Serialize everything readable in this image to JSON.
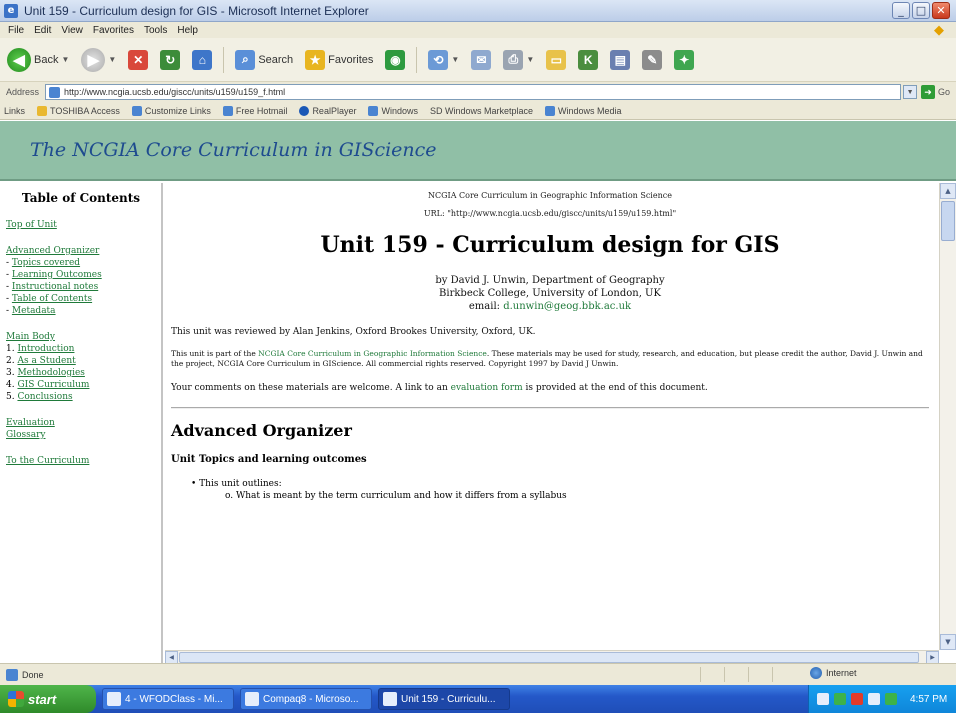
{
  "window": {
    "title": "Unit 159 - Curriculum design for GIS - Microsoft Internet Explorer",
    "controls": {
      "minimize": "_",
      "maximize": "□",
      "close": "✕"
    }
  },
  "menu": [
    "File",
    "Edit",
    "View",
    "Favorites",
    "Tools",
    "Help"
  ],
  "toolbar": {
    "back_label": "Back",
    "search_label": "Search",
    "favorites_label": "Favorites"
  },
  "address": {
    "label": "Address",
    "url": "http://www.ncgia.ucsb.edu/giscc/units/u159/u159_f.html",
    "go_label": "Go"
  },
  "links_bar": {
    "label": "Links",
    "items": [
      "TOSHIBA Access",
      "Customize Links",
      "Free Hotmail",
      "RealPlayer",
      "Windows",
      "SD Windows Marketplace",
      "Windows Media"
    ]
  },
  "banner": {
    "title": "The NCGIA Core Curriculum in GIScience"
  },
  "toc": {
    "heading": "Table of Contents",
    "top_of_unit": "Top of Unit",
    "advanced_organizer": "Advanced Organizer",
    "ao_items": [
      "Topics covered",
      "Learning Outcomes",
      "Instructional notes",
      "Table of Contents",
      "Metadata"
    ],
    "main_body": "Main Body",
    "body_items": [
      {
        "num": "1.",
        "label": "Introduction"
      },
      {
        "num": "2.",
        "label": "As a Student"
      },
      {
        "num": "3.",
        "label": "Methodologies"
      },
      {
        "num": "4.",
        "label": "GIS Curriculum"
      },
      {
        "num": "5.",
        "label": "Conclusions"
      }
    ],
    "evaluation": "Evaluation",
    "glossary": "Glossary",
    "to_curriculum": "To the Curriculum"
  },
  "content": {
    "header_line": "NCGIA Core Curriculum in Geographic Information Science",
    "url_line": "URL: \"http://www.ncgia.ucsb.edu/giscc/units/u159/u159.html\"",
    "title": "Unit 159 - Curriculum design for GIS",
    "byline_author": "by David J. Unwin, Department of Geography",
    "byline_affiliation": "Birkbeck College, University of London, UK",
    "byline_email_label": "email:",
    "byline_email": "d.unwin@geog.bbk.ac.uk",
    "reviewed": "This unit was reviewed by Alan Jenkins, Oxford Brookes University, Oxford, UK.",
    "part_of_prefix": "This unit is part of the",
    "part_of_link": "NCGIA Core Curriculum in Geographic Information Science",
    "part_of_suffix": ". These materials may be used for study, research, and education, but please credit the author, David J. Unwin and the project, NCGIA Core Curriculum in GIScience.  All commercial rights reserved.  Copyright 1997 by David J Unwin.",
    "comments_prefix": "Your comments on these materials are welcome. A link to an",
    "comments_link": "evaluation form",
    "comments_suffix": "is provided at the end of this document.",
    "section_title": "Advanced Organizer",
    "subsection_title": "Unit Topics and learning outcomes",
    "bullet": "This unit outlines:",
    "sub_bullet_marker": "o",
    "sub_bullet": "What is meant by the term curriculum and how it differs from a syllabus"
  },
  "status": {
    "text": "Done",
    "zone": "Internet"
  },
  "taskbar": {
    "start": "start",
    "tasks": [
      "4 - WFODClass - Mi...",
      "Compaq8 - Microso...",
      "Unit 159 - Curriculu..."
    ],
    "clock": "4:57 PM"
  }
}
